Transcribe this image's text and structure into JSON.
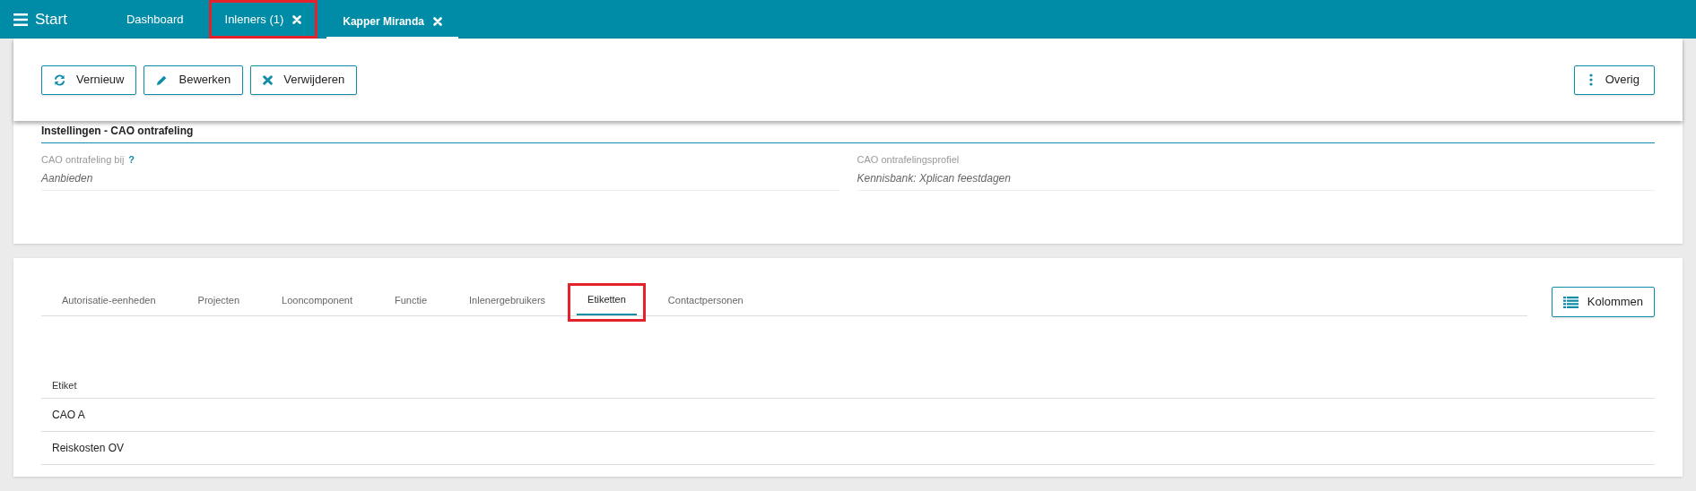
{
  "topbar": {
    "menu_label": "Start",
    "tabs": [
      {
        "label": "Dashboard",
        "selected": false,
        "closable": false,
        "highlighted": false
      },
      {
        "label": "Inleners (1)",
        "selected": false,
        "closable": true,
        "highlighted": true
      },
      {
        "label": "Kapper Miranda",
        "selected": true,
        "closable": true,
        "highlighted": false
      }
    ]
  },
  "toolbar": {
    "buttons": [
      {
        "label": "Vernieuw",
        "kind": "refresh"
      },
      {
        "label": "Bewerken",
        "kind": "edit"
      },
      {
        "label": "Verwijderen",
        "kind": "delete"
      }
    ],
    "more_button": "Overig"
  },
  "section": {
    "title": "Instellingen - CAO ontrafeling",
    "fields": [
      {
        "label": "CAO ontrafeling bij",
        "help": "?",
        "value": "Aanbieden"
      },
      {
        "label": "CAO ontrafelingsprofiel",
        "value": "Kennisbank: Xplican feestdagen"
      }
    ]
  },
  "detail_tabs": [
    {
      "label": "Autorisatie-eenheden",
      "selected": false,
      "highlighted": false
    },
    {
      "label": "Projecten",
      "selected": false,
      "highlighted": false
    },
    {
      "label": "Looncomponent",
      "selected": false,
      "highlighted": false
    },
    {
      "label": "Functie",
      "selected": false,
      "highlighted": false
    },
    {
      "label": "Inlenergebruikers",
      "selected": false,
      "highlighted": false
    },
    {
      "label": "Etiketten",
      "selected": true,
      "highlighted": true
    },
    {
      "label": "Contactpersonen",
      "selected": false,
      "highlighted": false
    }
  ],
  "columns_button": "Kolommen",
  "table": {
    "columns": [
      "Etiket"
    ],
    "rows": [
      [
        "CAO A"
      ],
      [
        "Reiskosten OV"
      ]
    ]
  }
}
